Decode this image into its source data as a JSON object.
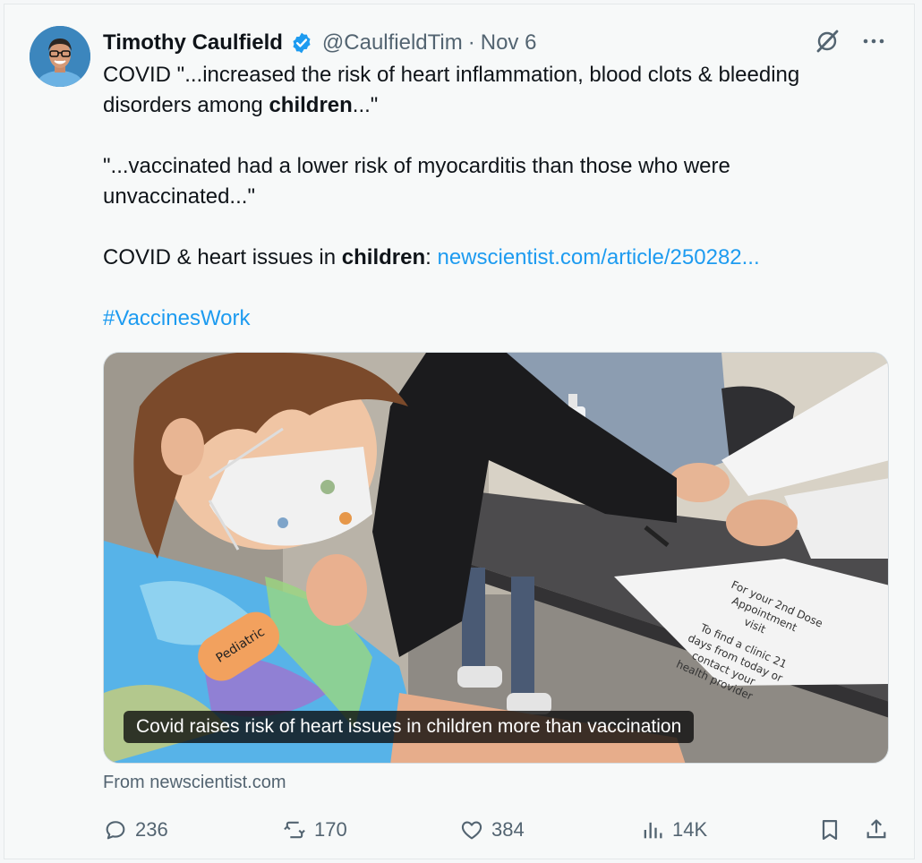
{
  "author": {
    "name": "Timothy Caulfield",
    "handle": "@CaulfieldTim",
    "separator": "·",
    "date": "Nov 6"
  },
  "tweet": {
    "line1_a": "COVID \"...increased the risk of heart inflammation, blood clots & bleeding",
    "line2_a": "disorders among ",
    "line2_bold": "children",
    "line2_b": "...\"",
    "line3": "\"...vaccinated had a lower risk of myocarditis than those who were",
    "line4": "unvaccinated...\"",
    "line5_a": "COVID & heart issues in ",
    "line5_bold": "children",
    "line5_b": ": ",
    "link": "newscientist.com/article/250282...",
    "hashtag": "#VaccinesWork"
  },
  "card": {
    "caption": "Covid raises risk of heart issues in children more than vaccination",
    "bandage_text": "Pediatric",
    "paper_text_1": "For your 2nd Dose",
    "paper_text_2": "Appointment",
    "paper_text_3": "visit",
    "paper_text_4": "To find a clinic 21",
    "paper_text_5": "days from today or",
    "paper_text_6": "contact your",
    "paper_text_7": "health provider",
    "source": "From newscientist.com"
  },
  "actions": {
    "replies": "236",
    "reposts": "170",
    "likes": "384",
    "views": "14K"
  },
  "colors": {
    "link": "#1d9bf0",
    "muted": "#536471",
    "verified": "#1d9bf0"
  }
}
